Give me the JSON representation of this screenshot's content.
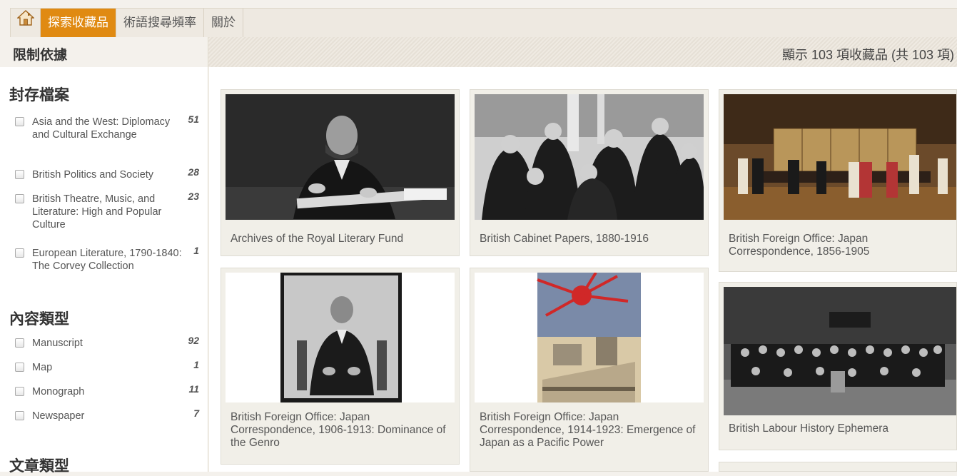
{
  "nav": {
    "items": [
      {
        "label": "探索收藏品",
        "active": true
      },
      {
        "label": "術語搜尋頻率",
        "active": false
      },
      {
        "label": "關於",
        "active": false
      }
    ],
    "home_icon": "home-icon",
    "active_color": "#e08a12"
  },
  "header": {
    "limit_title": "限制依據",
    "result_count": "顯示 103 項收藏品 (共 103 項)"
  },
  "facets": {
    "archives": {
      "title": "封存檔案",
      "items": [
        {
          "label": "Asia and the West: Diplomacy and Cultural Exchange",
          "count": "51"
        },
        {
          "label": "British Politics and Society",
          "count": "28"
        },
        {
          "label": "British Theatre, Music, and Literature: High and Popular Culture",
          "count": "23"
        },
        {
          "label": "European Literature, 1790-1840: The Corvey Collection",
          "count": "1"
        }
      ]
    },
    "content_type": {
      "title": "內容類型",
      "items": [
        {
          "label": "Manuscript",
          "count": "92"
        },
        {
          "label": "Map",
          "count": "1"
        },
        {
          "label": "Monograph",
          "count": "11"
        },
        {
          "label": "Newspaper",
          "count": "7"
        }
      ]
    },
    "article_type": {
      "title": "文章類型"
    }
  },
  "collections": [
    {
      "title": "Archives of the Royal Literary Fund"
    },
    {
      "title": "British Cabinet Papers, 1880-1916"
    },
    {
      "title": "British Foreign Office: Japan Correspondence, 1856-1905"
    },
    {
      "title": "British Foreign Office: Japan Correspondence, 1906-1913: Dominance of the Genro"
    },
    {
      "title": "British Foreign Office: Japan Correspondence, 1914-1923: Emergence of Japan as a Pacific Power"
    },
    {
      "title": "British Labour History Ephemera"
    }
  ]
}
